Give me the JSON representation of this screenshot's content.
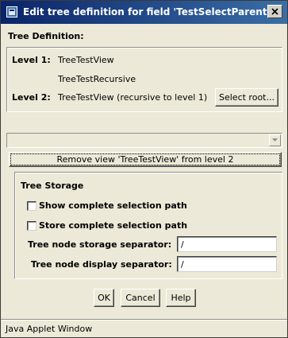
{
  "window": {
    "title": "Edit tree definition for field 'TestSelectParent'"
  },
  "tree_definition": {
    "section_label": "Tree Definition:",
    "level1_label": "Level 1:",
    "level1_value": "TreeTestView",
    "level1_sub_value": "TreeTestRecursive",
    "level2_label": "Level 2:",
    "level2_value": "TreeTestView (recursive to level 1)",
    "select_root_label": "Select root..."
  },
  "view_combo": {
    "value": ""
  },
  "remove_view_label": "Remove view 'TreeTestView' from level 2",
  "tree_storage": {
    "section_label": "Tree Storage",
    "show_path_label": "Show complete selection path",
    "show_path_checked": false,
    "store_path_label": "Store complete selection path",
    "store_path_checked": false,
    "storage_separator_label": "Tree node storage separator:",
    "storage_separator_value": "/",
    "display_separator_label": "Tree node display separator:",
    "display_separator_value": "/"
  },
  "buttons": {
    "ok": "OK",
    "cancel": "Cancel",
    "help": "Help"
  },
  "status": "Java Applet Window",
  "icons": {
    "title": "java-window-icon",
    "close": "close-x-icon",
    "combo": "chevron-down-icon"
  }
}
